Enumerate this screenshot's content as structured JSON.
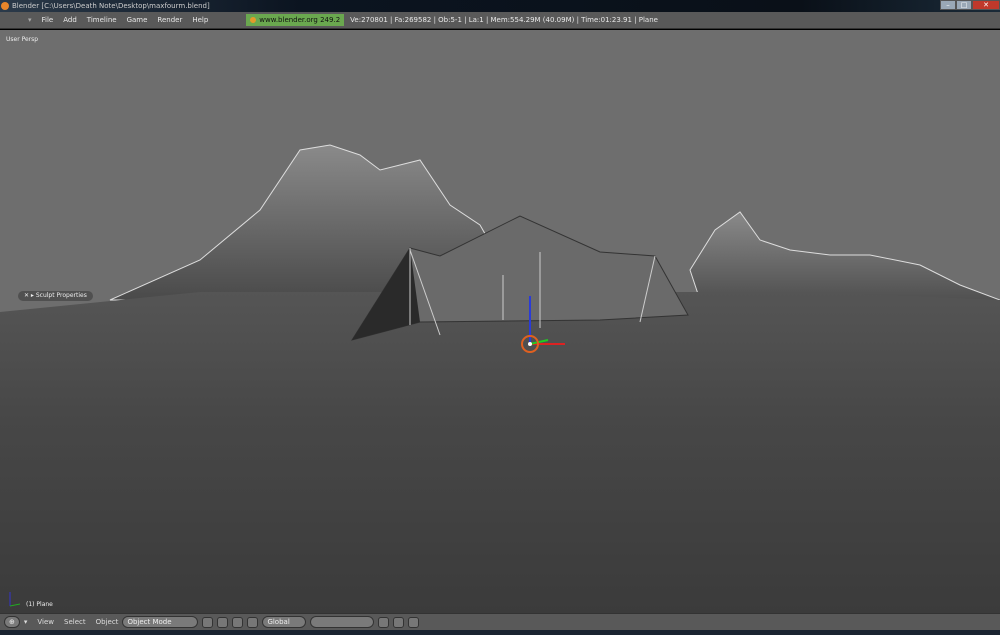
{
  "window": {
    "title": "Blender [C:\\Users\\Death Note\\Desktop\\maxfourm.blend]"
  },
  "menu": {
    "items": [
      "File",
      "Add",
      "Timeline",
      "Game",
      "Render",
      "Help"
    ]
  },
  "header": {
    "version": "www.blender.org 249.2",
    "stats": "Ve:270801 | Fa:269582 | Ob:5-1 | La:1  | Mem:554.29M (40.09M)  | Time:01:23.91 | Plane"
  },
  "viewport": {
    "view_label": "User Persp",
    "panel_label": "Sculpt Properties",
    "object_label": "(1) Plane"
  },
  "bottom": {
    "menus": [
      "View",
      "Select",
      "Object"
    ],
    "mode": "Object Mode",
    "orientation": "Global"
  },
  "colors": {
    "version_bg": "#6aa84f",
    "menubar": "#595959",
    "sky": "#6e6e6e"
  }
}
